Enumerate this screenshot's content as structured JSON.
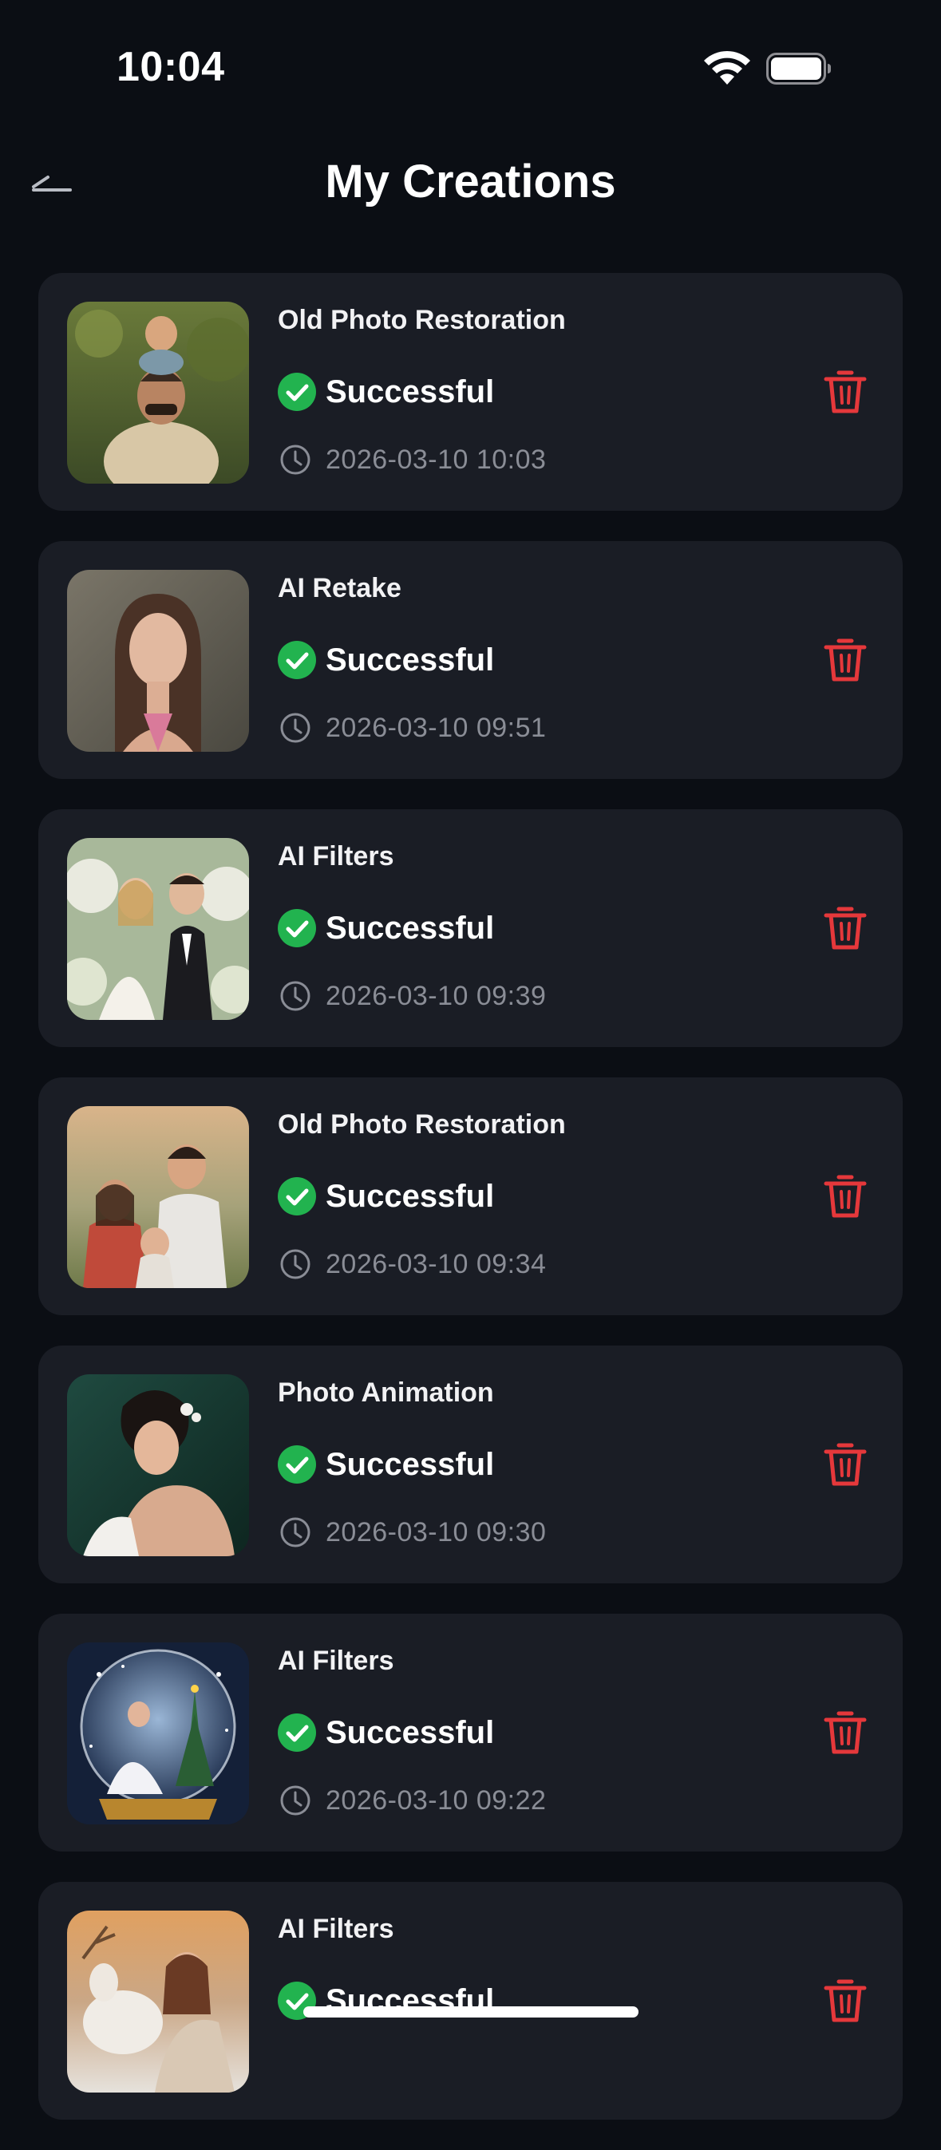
{
  "status_bar": {
    "time": "10:04",
    "icons": [
      "wifi-icon",
      "battery-icon"
    ]
  },
  "header": {
    "title": "My Creations",
    "back_icon": "back-arrow-icon"
  },
  "colors": {
    "background": "#0b0e14",
    "card": "#1a1d25",
    "success": "#22b34f",
    "delete": "#e5383b",
    "muted_text": "#8a8d96"
  },
  "creations": [
    {
      "title": "Old Photo Restoration",
      "status": "Successful",
      "timestamp": "2026-03-10 10:03",
      "thumbnail": "father-with-child-on-shoulders"
    },
    {
      "title": "AI Retake",
      "status": "Successful",
      "timestamp": "2026-03-10 09:51",
      "thumbnail": "woman-portrait"
    },
    {
      "title": "AI Filters",
      "status": "Successful",
      "timestamp": "2026-03-10 09:39",
      "thumbnail": "wedding-couple"
    },
    {
      "title": "Old Photo Restoration",
      "status": "Successful",
      "timestamp": "2026-03-10 09:34",
      "thumbnail": "family-portrait"
    },
    {
      "title": "Photo Animation",
      "status": "Successful",
      "timestamp": "2026-03-10 09:30",
      "thumbnail": "bride-portrait"
    },
    {
      "title": "AI Filters",
      "status": "Successful",
      "timestamp": "2026-03-10 09:22",
      "thumbnail": "snow-globe-christmas"
    },
    {
      "title": "AI Filters",
      "status": "Successful",
      "timestamp": "",
      "thumbnail": "woman-with-reindeer"
    }
  ]
}
